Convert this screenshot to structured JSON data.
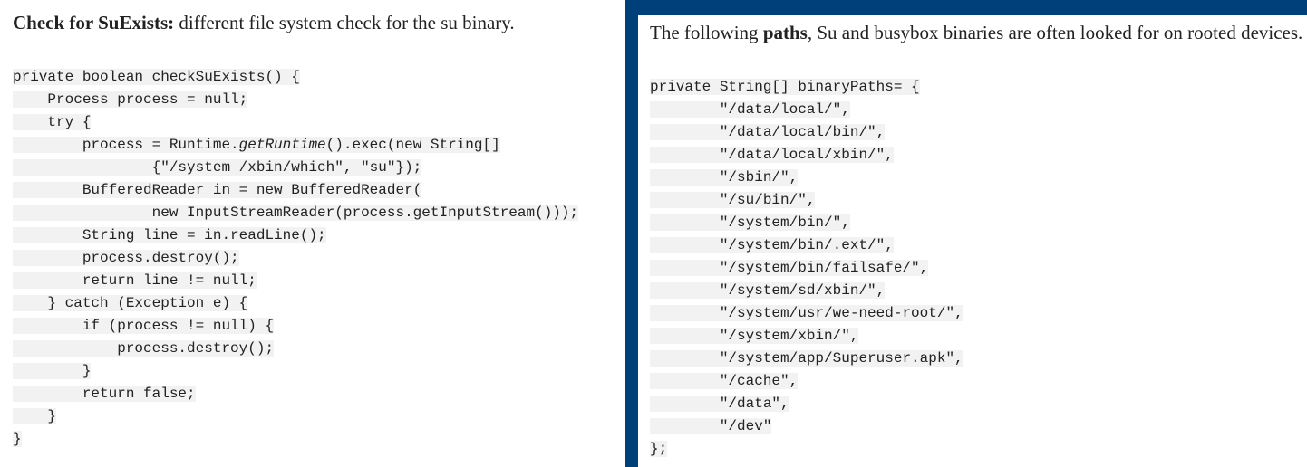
{
  "left": {
    "heading_bold": "Check for SuExists:",
    "heading_rest": " different file system check for the su binary.",
    "code_lines": [
      {
        "indent": "",
        "text": "private boolean checkSuExists() {"
      },
      {
        "indent": "    ",
        "text": "Process process = null;"
      },
      {
        "indent": "    ",
        "text": "try {"
      },
      {
        "indent": "        ",
        "pre": "process = Runtime.",
        "italic": "getRuntime",
        "post": "().exec(new String[]"
      },
      {
        "indent": "                ",
        "text": "{\"/system /xbin/which\", \"su\"});"
      },
      {
        "indent": "        ",
        "text": "BufferedReader in = new BufferedReader("
      },
      {
        "indent": "                ",
        "text": "new InputStreamReader(process.getInputStream()));"
      },
      {
        "indent": "        ",
        "text": "String line = in.readLine();"
      },
      {
        "indent": "        ",
        "text": "process.destroy();"
      },
      {
        "indent": "        ",
        "text": "return line != null;"
      },
      {
        "indent": "    ",
        "text": "} catch (Exception e) {"
      },
      {
        "indent": "        ",
        "text": "if (process != null) {"
      },
      {
        "indent": "            ",
        "text": "process.destroy();"
      },
      {
        "indent": "        ",
        "text": "}"
      },
      {
        "indent": "        ",
        "text": "return false;"
      },
      {
        "indent": "    ",
        "text": "}"
      },
      {
        "indent": "",
        "text": "}"
      }
    ]
  },
  "right": {
    "text_pre": "The following ",
    "text_bold": "paths",
    "text_post": ", Su and busybox binaries are often looked for on rooted devices.",
    "code_lines": [
      {
        "indent": "",
        "text": "private String[] binaryPaths= {"
      },
      {
        "indent": "        ",
        "text": "\"/data/local/\","
      },
      {
        "indent": "        ",
        "text": "\"/data/local/bin/\","
      },
      {
        "indent": "        ",
        "text": "\"/data/local/xbin/\","
      },
      {
        "indent": "        ",
        "text": "\"/sbin/\","
      },
      {
        "indent": "        ",
        "text": "\"/su/bin/\","
      },
      {
        "indent": "        ",
        "text": "\"/system/bin/\","
      },
      {
        "indent": "        ",
        "text": "\"/system/bin/.ext/\","
      },
      {
        "indent": "        ",
        "text": "\"/system/bin/failsafe/\","
      },
      {
        "indent": "        ",
        "text": "\"/system/sd/xbin/\","
      },
      {
        "indent": "        ",
        "text": "\"/system/usr/we-need-root/\","
      },
      {
        "indent": "        ",
        "text": "\"/system/xbin/\","
      },
      {
        "indent": "        ",
        "text": "\"/system/app/Superuser.apk\","
      },
      {
        "indent": "        ",
        "text": "\"/cache\","
      },
      {
        "indent": "        ",
        "text": "\"/data\","
      },
      {
        "indent": "        ",
        "text": "\"/dev\""
      },
      {
        "indent": "",
        "text": "};"
      }
    ]
  },
  "colors": {
    "frame": "#00407a",
    "code_bg": "#f2f2f2",
    "text": "#222222"
  }
}
